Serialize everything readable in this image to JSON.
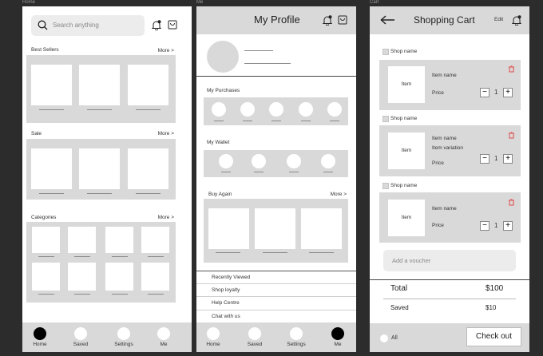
{
  "frames": {
    "home": "Home",
    "me": "Me",
    "cart": "Cart"
  },
  "home": {
    "search_placeholder": "Search anything",
    "best_sellers": {
      "title": "Best Sellers",
      "more": "More >"
    },
    "sale": {
      "title": "Sale",
      "more": "More >"
    },
    "categories": {
      "title": "Categories",
      "more": "More >"
    },
    "nav": [
      "Home",
      "Saved",
      "Settings",
      "Me"
    ]
  },
  "me": {
    "title": "My Profile",
    "purchases_title": "My Purchases",
    "wallet_title": "My Wallet",
    "buy_again": {
      "title": "Buy Again",
      "more": "More >"
    },
    "menu": [
      "Recently Viewed",
      "Shop loyalty",
      "Help Centre",
      "Chat with us"
    ],
    "nav": [
      "Home",
      "Saved",
      "Settings",
      "Me"
    ]
  },
  "cart": {
    "title": "Shopping Cart",
    "edit": "Edit",
    "items": [
      {
        "shop": "Shop name",
        "image": "Item",
        "name": "Item name",
        "variation": "",
        "price": "Price",
        "qty": "1"
      },
      {
        "shop": "Shop name",
        "image": "Item",
        "name": "Item name",
        "variation": "Item variation",
        "price": "Price",
        "qty": "1"
      },
      {
        "shop": "Shop name",
        "image": "Item",
        "name": "Item name",
        "variation": "",
        "price": "Price",
        "qty": "1"
      }
    ],
    "voucher_placeholder": "Add a voucher",
    "total_label": "Total",
    "total_value": "$100",
    "saved_label": "Saved",
    "saved_value": "$10",
    "all_label": "All",
    "checkout_label": "Check out"
  },
  "colors": {
    "panel": "#d9d9d9",
    "background": "#2c2c2c",
    "delete_icon": "#e04a4a"
  }
}
